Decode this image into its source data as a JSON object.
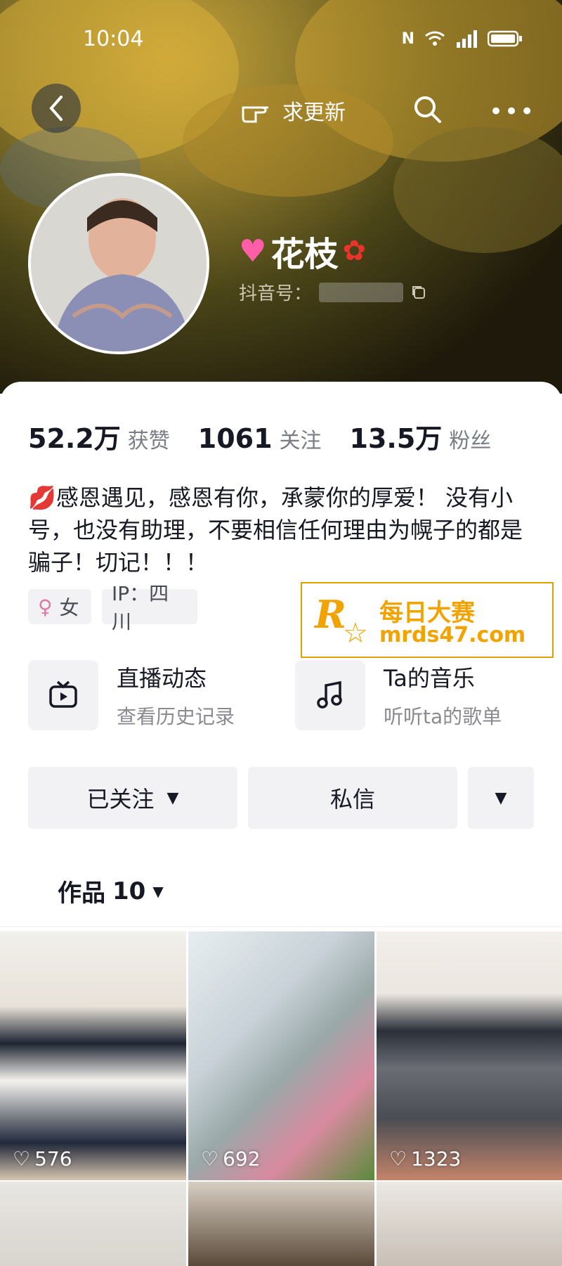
{
  "status": {
    "time": "10:04"
  },
  "header": {
    "request_update": "求更新"
  },
  "profile": {
    "name": "花枝",
    "douyin_id_label": "抖音号："
  },
  "stats": [
    {
      "value": "52.2万",
      "label": "获赞"
    },
    {
      "value": "1061",
      "label": "关注"
    },
    {
      "value": "13.5万",
      "label": "粉丝"
    }
  ],
  "bio": "感恩遇见，感恩有你，承蒙你的厚爱！ 没有小号，也没有助理，不要相信任何理由为幌子的都是骗子！切记！！！",
  "tags": {
    "gender": "女",
    "ip": "IP：四川"
  },
  "ad": {
    "line1": "每日大赛",
    "line2": "mrds47.com",
    "logo": "R"
  },
  "features": [
    {
      "title": "直播动态",
      "subtitle": "查看历史记录",
      "icon": "tv-icon"
    },
    {
      "title": "Ta的音乐",
      "subtitle": "听听ta的歌单",
      "icon": "music-note-icon"
    }
  ],
  "actions": {
    "followed": "已关注",
    "message": "私信"
  },
  "works_tab": {
    "label": "作品",
    "count": "10"
  },
  "videos": [
    {
      "likes": "576"
    },
    {
      "likes": "692"
    },
    {
      "likes": "1323"
    }
  ],
  "colors": {
    "accent_ad": "#f2a300",
    "text_primary": "#161823",
    "text_secondary": "#7b7d85"
  }
}
